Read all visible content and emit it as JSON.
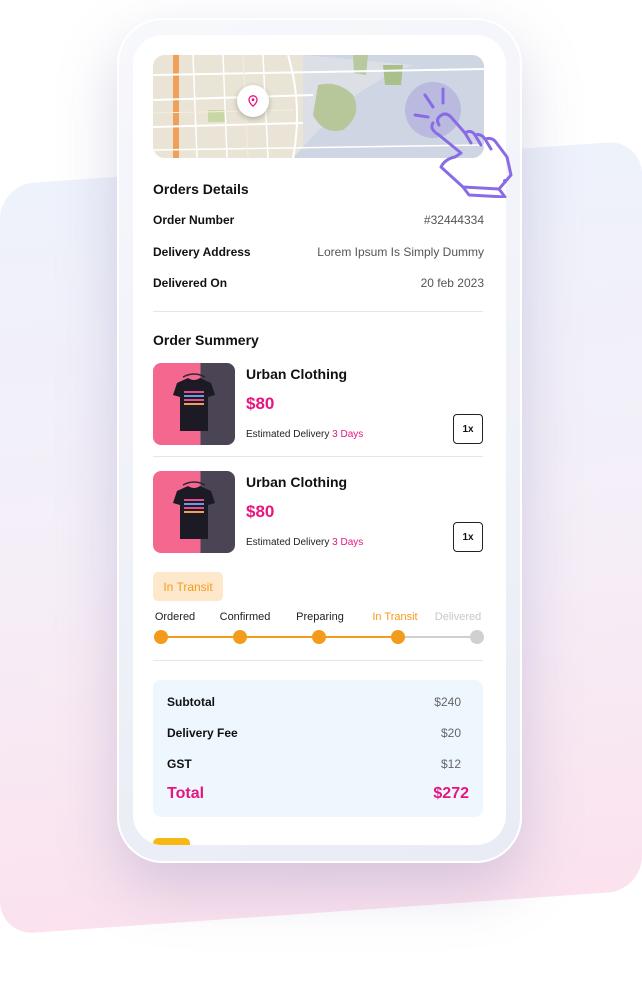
{
  "orders_details": {
    "title": "Orders Details",
    "order_number_label": "Order Number",
    "order_number_value": "#32444334",
    "delivery_address_label": "Delivery Address",
    "delivery_address_value": "Lorem Ipsum Is Simply Dummy",
    "delivered_on_label": "Delivered On",
    "delivered_on_value": "20 feb 2023"
  },
  "order_summary": {
    "title": "Order Summery",
    "items": [
      {
        "name": "Urban Clothing",
        "price": "$80",
        "delivery_label": "Estimated Delivery",
        "delivery_value": "3 Days",
        "qty": "1x"
      },
      {
        "name": "Urban Clothing",
        "price": "$80",
        "delivery_label": "Estimated Delivery",
        "delivery_value": "3 Days",
        "qty": "1x"
      }
    ]
  },
  "status": {
    "badge": "In Transit",
    "steps": [
      "Ordered",
      "Confirmed",
      "Preparing",
      "In Transit",
      "Delivered"
    ],
    "current_step_index": 3
  },
  "totals": {
    "subtotal_label": "Subtotal",
    "subtotal_value": "$240",
    "delivery_fee_label": "Delivery Fee",
    "delivery_fee_value": "$20",
    "gst_label": "GST",
    "gst_value": "$12",
    "total_label": "Total",
    "total_value": "$272"
  },
  "colors": {
    "accent_pink": "#e6157f",
    "status_orange": "#f39b1b",
    "inactive_gray": "#d0d0d0"
  },
  "icons": {
    "map_pin": "location-pin-icon",
    "cursor": "hand-pointer-icon"
  }
}
